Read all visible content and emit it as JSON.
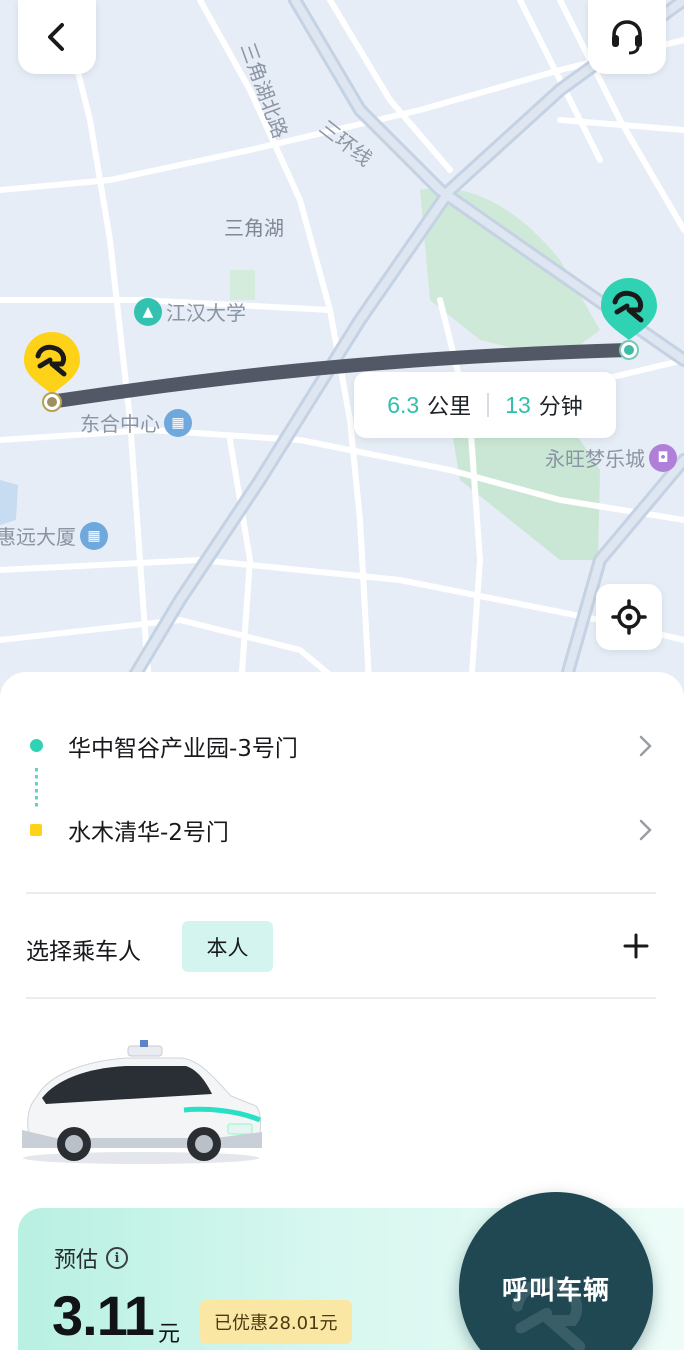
{
  "map": {
    "road_labels": {
      "road1": "三角湖北路",
      "road2": "三环线"
    },
    "area_labels": {
      "lake": "三角湖"
    },
    "pois": {
      "university": "江汉大学",
      "center": "东合中心",
      "mall": "永旺梦乐城",
      "building": "惠远大厦"
    },
    "route": {
      "distance_value": "6.3",
      "distance_unit": "公里",
      "time_value": "13",
      "time_unit": "分钟"
    },
    "icons": {
      "back": "chevron-left-icon",
      "support": "headset-icon",
      "locate": "crosshair-icon",
      "pickup": "robotaxi-logo-icon",
      "dropoff": "robotaxi-logo-icon"
    }
  },
  "trip": {
    "pickup": "华中智谷产业园-3号门",
    "dropoff": "水木清华-2号门"
  },
  "passenger": {
    "label": "选择乘车人",
    "selected": "本人"
  },
  "estimate": {
    "label": "预估",
    "price": "3.11",
    "currency": "元",
    "discount": "已优惠28.01元"
  },
  "call_button": {
    "label": "呼叫车辆"
  },
  "colors": {
    "accent": "#2ec0ad",
    "pickup_pin": "#ffd21a",
    "dropoff_pin": "#2fd3b4",
    "call_button": "#1f4853",
    "discount_bg": "#fbe7a4",
    "route_line": "#525866"
  }
}
